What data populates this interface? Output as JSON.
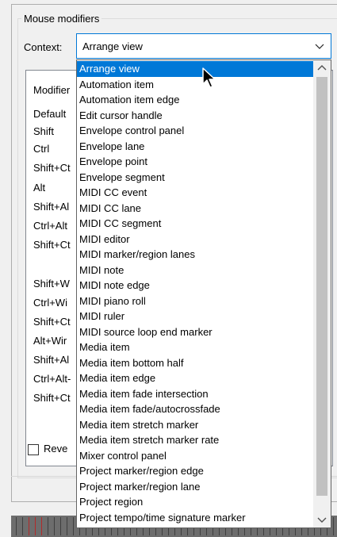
{
  "group": {
    "title": "Mouse modifiers"
  },
  "context": {
    "label": "Context:",
    "value": "Arrange view"
  },
  "background_list": {
    "header": "Modifier",
    "rows": [
      "Default",
      "Shift",
      "Ctrl",
      "Shift+Ct",
      "Alt",
      "Shift+Al",
      "Ctrl+Alt",
      "Shift+Ct",
      "Shift+W",
      "Ctrl+Wi",
      "Shift+Ct",
      "Alt+Wir",
      "Shift+Al",
      "Ctrl+Alt-",
      "Shift+Ct"
    ]
  },
  "reverse": {
    "label": "Reve",
    "checked": false
  },
  "dropdown": {
    "selected_index": 0,
    "items": [
      "Arrange view",
      "Automation item",
      "Automation item edge",
      "Edit cursor handle",
      "Envelope control panel",
      "Envelope lane",
      "Envelope point",
      "Envelope segment",
      "MIDI CC event",
      "MIDI CC lane",
      "MIDI CC segment",
      "MIDI editor",
      "MIDI marker/region lanes",
      "MIDI note",
      "MIDI note edge",
      "MIDI piano roll",
      "MIDI ruler",
      "MIDI source loop end marker",
      "Media item",
      "Media item bottom half",
      "Media item edge",
      "Media item fade intersection",
      "Media item fade/autocrossfade",
      "Media item stretch marker",
      "Media item stretch marker rate",
      "Mixer control panel",
      "Project marker/region edge",
      "Project marker/region lane",
      "Project region",
      "Project tempo/time signature marker"
    ]
  },
  "icons": {
    "combo_chevron": "chevron-down-icon",
    "scroll_up": "scroll-up-arrow-icon",
    "scroll_down": "scroll-down-arrow-icon",
    "cursor": "mouse-pointer-icon"
  },
  "colors": {
    "selection": "#0078d7",
    "focus_border": "#0078d7"
  }
}
